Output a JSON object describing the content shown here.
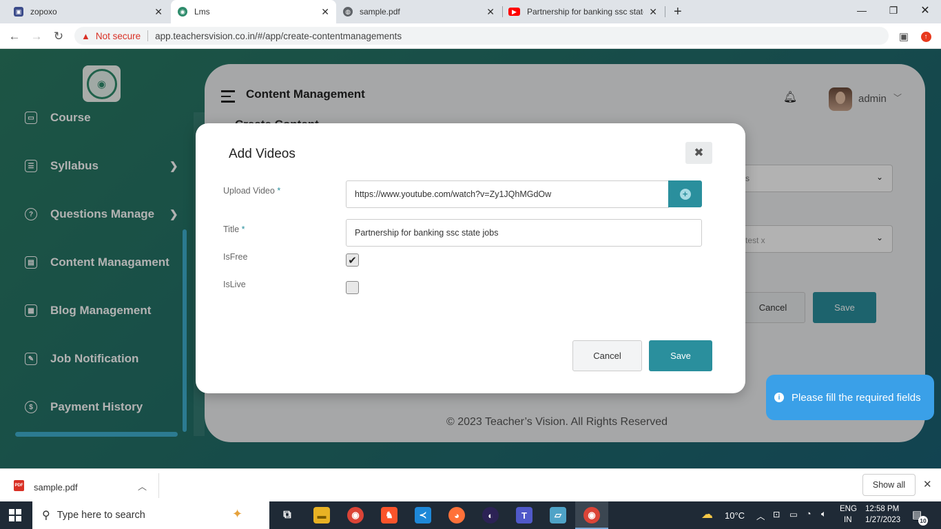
{
  "browser": {
    "tabs": [
      {
        "title": "zopoxo",
        "favicon": "app-square-icon",
        "color": "#3b4b8a"
      },
      {
        "title": "Lms",
        "favicon": "teachersvision-icon",
        "color": "#2f8c6c"
      },
      {
        "title": "sample.pdf",
        "favicon": "globe-icon",
        "color": "#5f6368"
      },
      {
        "title": "Partnership for banking ssc state",
        "favicon": "youtube-icon",
        "color": "#ff0000"
      }
    ],
    "new_tab": "+",
    "not_secure": "Not secure",
    "url": "app.teachersvision.co.in/#/app/create-contentmanagements"
  },
  "sidebar": {
    "items": [
      {
        "label": "Course",
        "icon": "book-icon"
      },
      {
        "label": "Syllabus",
        "icon": "list-icon",
        "arrow": true
      },
      {
        "label": "Questions Manage",
        "icon": "question-circle-icon",
        "arrow": true
      },
      {
        "label": "Content Managament",
        "icon": "content-icon"
      },
      {
        "label": "Blog Management",
        "icon": "blog-icon"
      },
      {
        "label": "Job Notification",
        "icon": "clipboard-icon"
      },
      {
        "label": "Payment History",
        "icon": "payment-icon"
      }
    ]
  },
  "header": {
    "title": "Content Management",
    "username": "admin"
  },
  "main": {
    "section_title": "Create Content",
    "select_partial_1": "s",
    "select_partial_2": "test x",
    "cancel_label": "Cancel",
    "save_label": "Save",
    "footer": "© 2023 Teacher’s Vision. All Rights Reserved"
  },
  "modal": {
    "title": "Add Videos",
    "close": "✖",
    "fields": {
      "upload_label": "Upload Video",
      "upload_value": "https://www.youtube.com/watch?v=Zy1JQhMGdOw",
      "title_label": "Title",
      "title_value": "Partnership for banking ssc state jobs",
      "isfree_label": "IsFree",
      "isfree_checked": true,
      "islive_label": "IsLive",
      "islive_checked": false,
      "required_mark": "*"
    },
    "cancel_label": "Cancel",
    "save_label": "Save"
  },
  "toast": {
    "message": "Please fill the required fields"
  },
  "download_bar": {
    "file_name": "sample.pdf",
    "show_all": "Show all"
  },
  "taskbar": {
    "search_placeholder": "Type here to search",
    "weather": "10°C",
    "lang_1": "ENG",
    "lang_2": "IN",
    "time": "12:58 PM",
    "date": "1/27/2023",
    "notification_count": "10"
  },
  "colors": {
    "accent": "#2a8f9d",
    "sidebar_gradient": "#237068",
    "toast": "#3aa0e8"
  }
}
